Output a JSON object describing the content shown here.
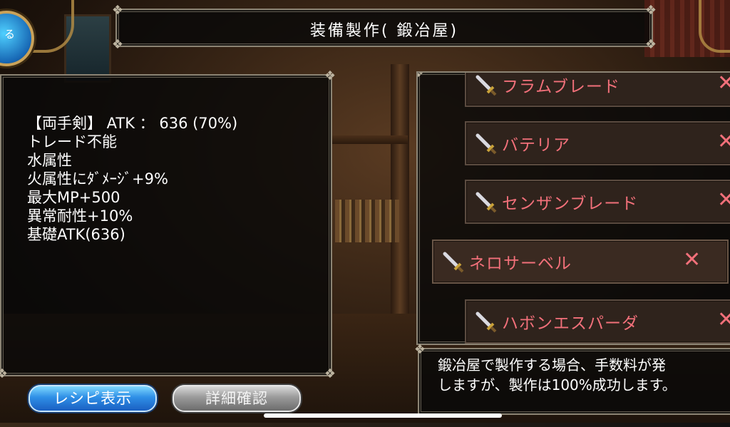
{
  "header": {
    "title": "装備製作( 鍛冶屋)"
  },
  "back_button": {
    "label": "る"
  },
  "stats": {
    "lines": [
      "【両手剣】 ATK ： 636 (70%)",
      "トレード不能",
      "水属性",
      "火属性にﾀﾞﾒｰｼﾞ+9%",
      "最大MP+500",
      "異常耐性+10%",
      "基礎ATK(636)"
    ]
  },
  "recipes": {
    "items": [
      {
        "name": "フラムブレード",
        "icon": "sword-icon",
        "remove": "✕"
      },
      {
        "name": "バテリア",
        "icon": "sword-icon",
        "remove": "✕"
      },
      {
        "name": "センザンブレード",
        "icon": "sword-icon",
        "remove": "✕"
      },
      {
        "name": "ネロサーベル",
        "icon": "sword-icon",
        "remove": "✕"
      },
      {
        "name": "ハボンエスパーダ",
        "icon": "sword-icon",
        "remove": "✕"
      }
    ],
    "selected_index": 3,
    "name_color": "#f2707a"
  },
  "description": {
    "line1": "鍛冶屋で製作する場合、手数料が発",
    "line2": "しますが、製作は100%成功します。"
  },
  "buttons": {
    "recipe_label": "レシピ表示",
    "detail_label": "詳細確認"
  }
}
